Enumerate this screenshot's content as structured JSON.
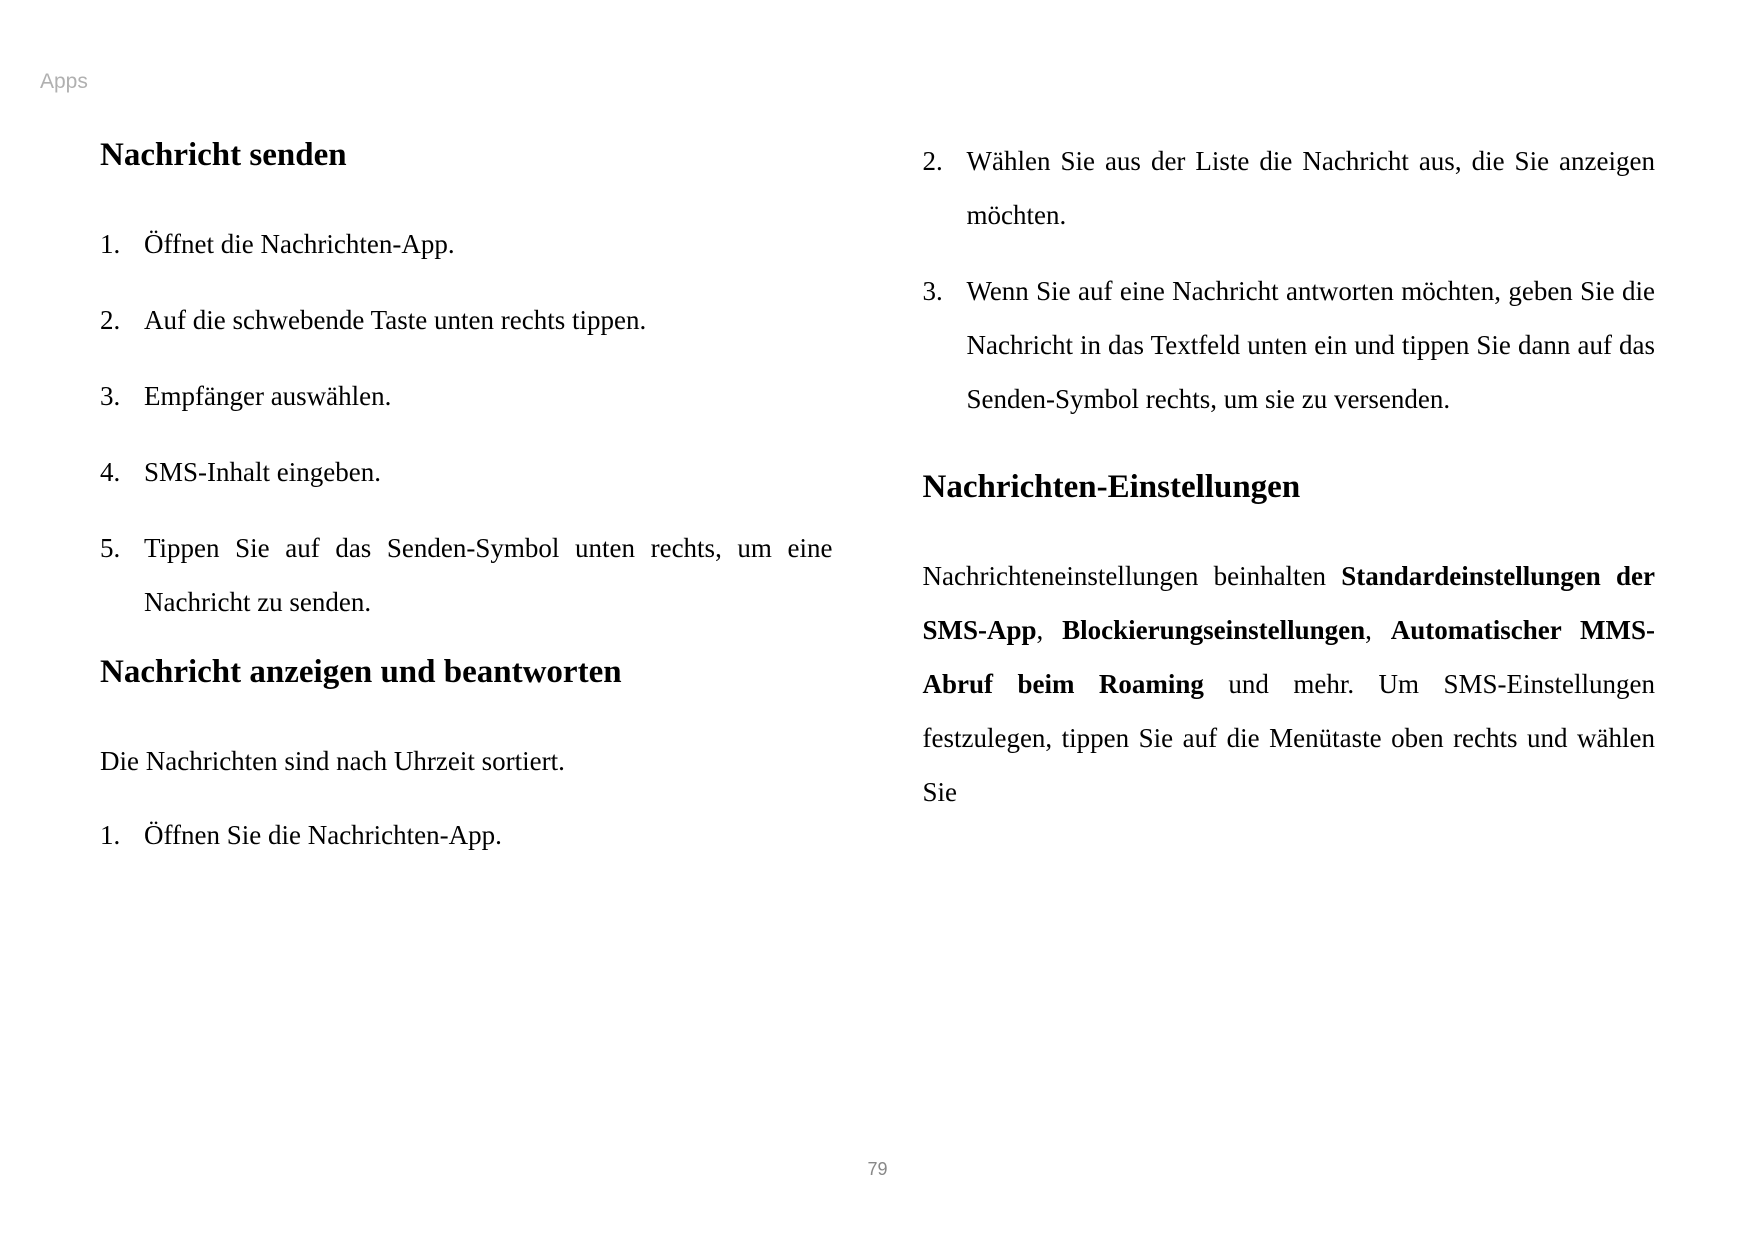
{
  "header": "Apps",
  "page_number": "79",
  "left": {
    "heading1": "Nachricht senden",
    "list1": [
      "Öffnet die Nachrichten-App.",
      "Auf die schwebende Taste unten rechts tippen.",
      "Empfänger auswählen.",
      "SMS-Inhalt eingeben.",
      "Tippen Sie auf das Senden-Symbol unten rechts, um eine Nachricht zu senden."
    ],
    "heading2": "Nachricht anzeigen und beantworten",
    "para1": "Die Nachrichten sind nach Uhrzeit sortiert.",
    "list2": [
      "Öffnen Sie die Nachrichten-App."
    ]
  },
  "right": {
    "list1": [
      "Wählen Sie aus der Liste die Nachricht aus, die Sie anzeigen möchten.",
      "Wenn Sie auf eine Nachricht antworten möchten, geben Sie die Nachricht in das Textfeld unten ein und tippen Sie dann auf das Senden-Symbol rechts, um sie zu versenden."
    ],
    "heading1": "Nachrichten-Einstellungen",
    "para1_pre": "Nachrichteneinstellungen beinhalten ",
    "bold1": "Standardeinstellungen der SMS-App",
    "sep1": ", ",
    "bold2": "Blockierungseinstellungen",
    "sep2": ", ",
    "bold3": "Automatischer MMS-Abruf beim Roaming",
    "para1_post": " und mehr. Um SMS-Einstellungen festzulegen, tippen Sie auf die Menütaste oben rechts und wählen Sie"
  }
}
